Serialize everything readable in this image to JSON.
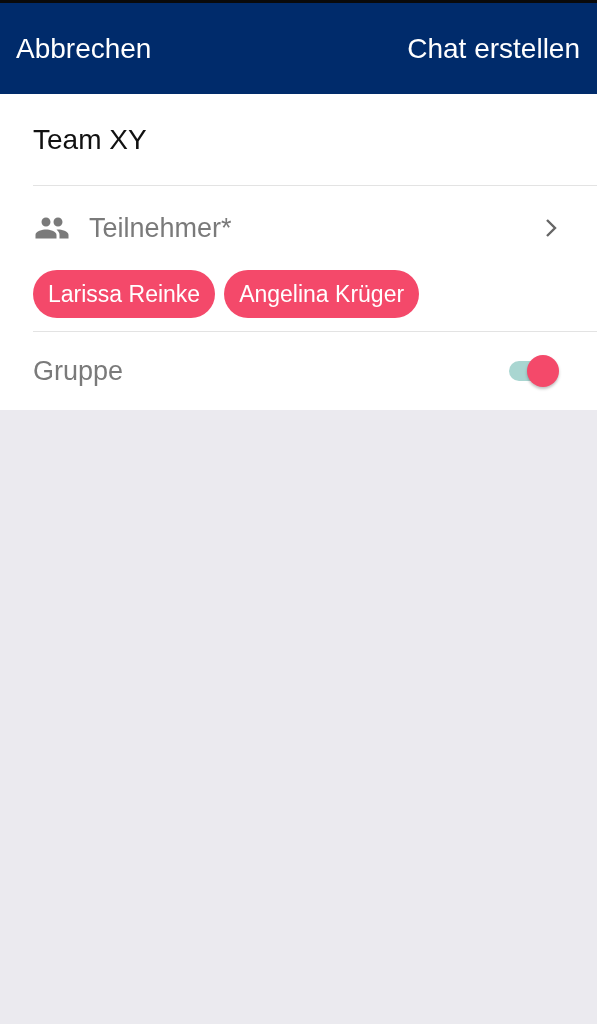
{
  "navbar": {
    "cancel": "Abbrechen",
    "create": "Chat erstellen"
  },
  "name_field": {
    "value": "Team XY"
  },
  "participants": {
    "label": "Teilnehmer*",
    "chips": [
      {
        "label": "Larissa Reinke"
      },
      {
        "label": "Angelina Krüger"
      }
    ]
  },
  "group_toggle": {
    "label": "Gruppe",
    "on": true
  }
}
